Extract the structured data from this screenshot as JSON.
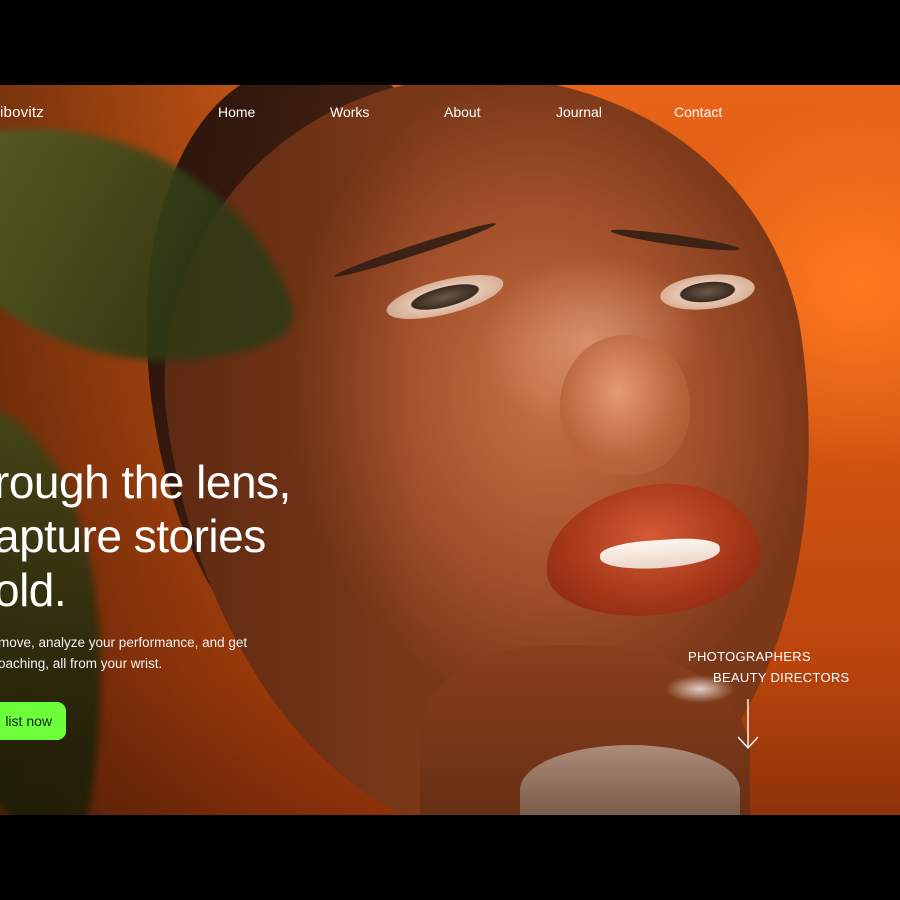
{
  "brand": {
    "name": "ibovitz"
  },
  "nav": {
    "items": [
      {
        "label": "Home"
      },
      {
        "label": "Works"
      },
      {
        "label": "About"
      },
      {
        "label": "Journal"
      },
      {
        "label": "Contact"
      }
    ]
  },
  "hero": {
    "headline": [
      "rough the lens,",
      "apture stories",
      "old."
    ],
    "subtext": [
      "move, analyze your performance, and get",
      "oaching, all from your wrist."
    ],
    "cta_label": "list now",
    "roles": [
      "PHOTOGRAPHERS",
      "BEAUTY DIRECTORS"
    ],
    "scroll_icon": "arrow-down-icon"
  },
  "colors": {
    "accent": "#6cff3a",
    "background": "#d55612",
    "text": "#ffffff"
  }
}
